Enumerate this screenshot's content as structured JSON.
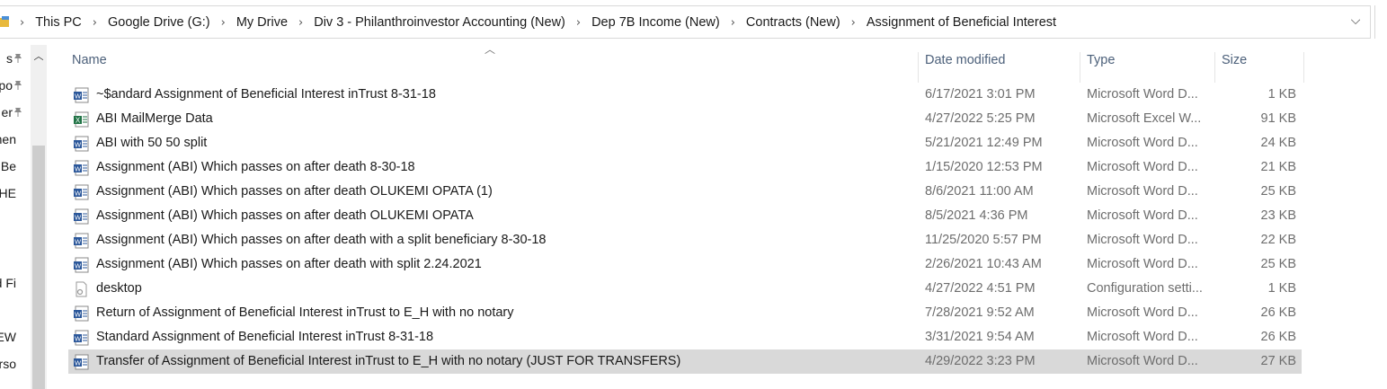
{
  "address_bar": {
    "breadcrumbs": [
      "This PC",
      "Google Drive (G:)",
      "My Drive",
      "Div 3 - Philanthroinvestor Accounting (New)",
      "Dep 7B Income (New)",
      "Contracts (New)",
      "Assignment of Beneficial Interest"
    ]
  },
  "nav_pane": {
    "items": [
      {
        "label": "s",
        "pinned": true
      },
      {
        "label": "po",
        "pinned": true
      },
      {
        "label": "er",
        "pinned": true
      },
      {
        "label": "cumen",
        "pinned": false
      },
      {
        "label": "of Be",
        "pinned": false
      },
      {
        "label": "E THE",
        "pinned": false
      },
      {
        "label": "oud Fi",
        "pinned": false
      },
      {
        "label": "NEW",
        "pinned": false
      },
      {
        "label": "Perso",
        "pinned": false
      }
    ]
  },
  "columns": {
    "name": "Name",
    "date": "Date modified",
    "type": "Type",
    "size": "Size"
  },
  "files": [
    {
      "icon": "word",
      "name": "~$andard Assignment of Beneficial Interest inTrust 8-31-18",
      "date": "6/17/2021 3:01 PM",
      "type": "Microsoft Word D...",
      "size": "1 KB"
    },
    {
      "icon": "excel",
      "name": "ABI MailMerge Data",
      "date": "4/27/2022 5:25 PM",
      "type": "Microsoft Excel W...",
      "size": "91 KB"
    },
    {
      "icon": "word",
      "name": "ABI with 50 50 split",
      "date": "5/21/2021 12:49 PM",
      "type": "Microsoft Word D...",
      "size": "24 KB"
    },
    {
      "icon": "word",
      "name": "Assignment (ABI) Which passes on after death 8-30-18",
      "date": "1/15/2020 12:53 PM",
      "type": "Microsoft Word D...",
      "size": "21 KB"
    },
    {
      "icon": "word",
      "name": "Assignment (ABI) Which passes on after death OLUKEMI OPATA (1)",
      "date": "8/6/2021 11:00 AM",
      "type": "Microsoft Word D...",
      "size": "25 KB"
    },
    {
      "icon": "word",
      "name": "Assignment (ABI) Which passes on after death OLUKEMI OPATA",
      "date": "8/5/2021 4:36 PM",
      "type": "Microsoft Word D...",
      "size": "23 KB"
    },
    {
      "icon": "word",
      "name": "Assignment (ABI) Which passes on after death with a split beneficiary 8-30-18",
      "date": "11/25/2020 5:57 PM",
      "type": "Microsoft Word D...",
      "size": "22 KB"
    },
    {
      "icon": "word",
      "name": "Assignment (ABI) Which passes on after death with split 2.24.2021",
      "date": "2/26/2021 10:43 AM",
      "type": "Microsoft Word D...",
      "size": "25 KB"
    },
    {
      "icon": "config",
      "name": "desktop",
      "date": "4/27/2022 4:51 PM",
      "type": "Configuration setti...",
      "size": "1 KB"
    },
    {
      "icon": "word",
      "name": "Return of Assignment of Beneficial Interest inTrust to E_H with no notary",
      "date": "7/28/2021 9:52 AM",
      "type": "Microsoft Word D...",
      "size": "26 KB"
    },
    {
      "icon": "word",
      "name": "Standard Assignment of Beneficial Interest inTrust 8-31-18",
      "date": "3/31/2021 9:54 AM",
      "type": "Microsoft Word D...",
      "size": "26 KB"
    },
    {
      "icon": "word",
      "name": "Transfer of Assignment of Beneficial Interest inTrust to E_H with no notary (JUST FOR TRANSFERS)",
      "date": "4/29/2022 3:23 PM",
      "type": "Microsoft Word D...",
      "size": "27 KB",
      "selected": true
    }
  ],
  "colors": {
    "selection": "#d9d9d9",
    "word_blue": "#2b579a",
    "excel_green": "#217346",
    "header_text": "#4c607a"
  }
}
